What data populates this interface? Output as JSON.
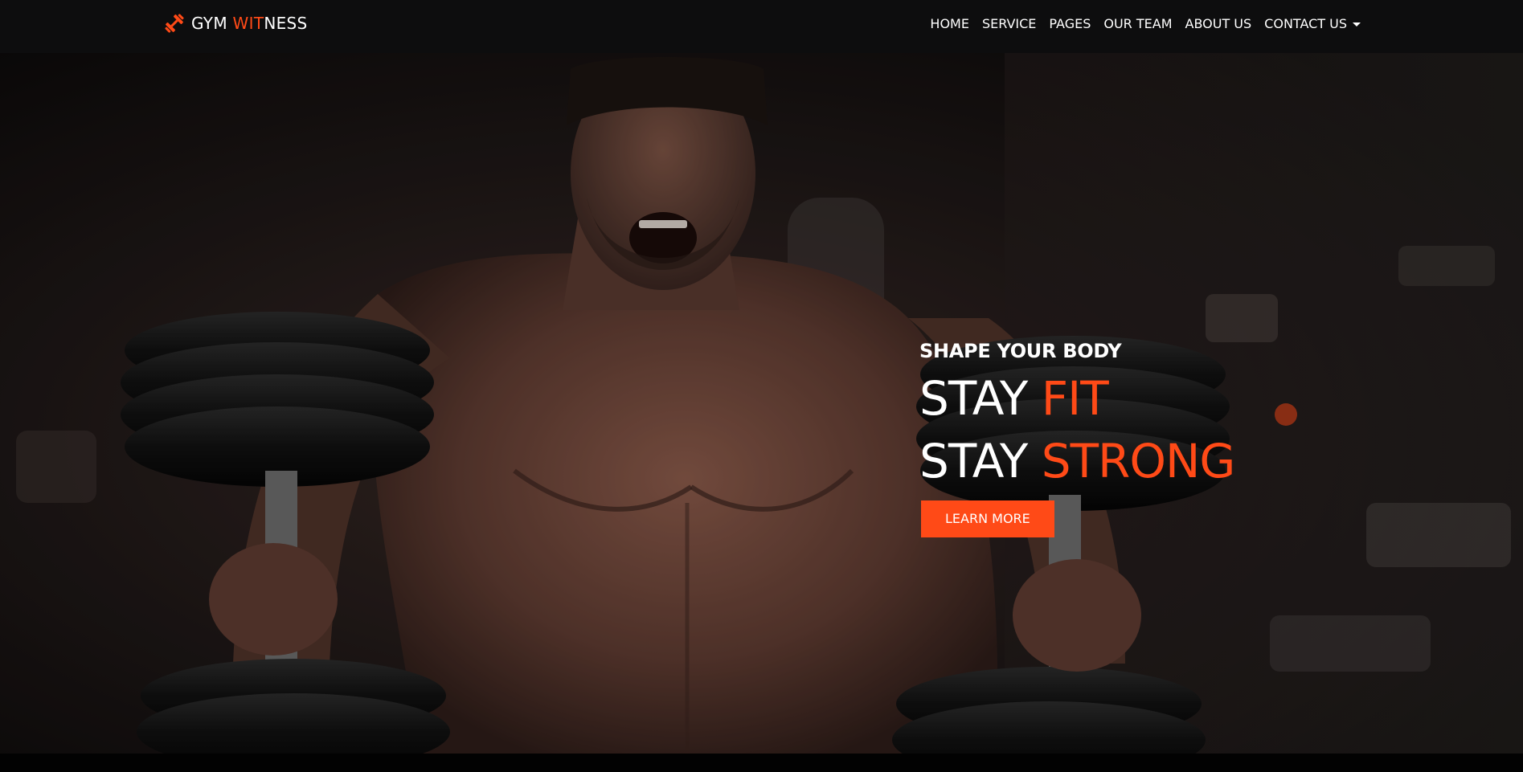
{
  "brand": {
    "name_part1": "GYM ",
    "name_accent": "WIT",
    "name_part2": "NESS",
    "icon": "dumbbell-icon",
    "accent_color": "#ff4a17"
  },
  "nav": {
    "items": [
      {
        "label": "HOME"
      },
      {
        "label": "SERVICE"
      },
      {
        "label": "PAGES"
      },
      {
        "label": "OUR TEAM"
      },
      {
        "label": "ABOUT US"
      },
      {
        "label": "CONTACT US",
        "dropdown": true
      }
    ]
  },
  "hero": {
    "subtitle": "SHAPE YOUR BODY",
    "line1_plain": "STAY ",
    "line1_accent": "FIT",
    "line2_plain": "STAY ",
    "line2_accent": "STRONG",
    "cta_label": "LEARN MORE",
    "image": "bodybuilder lifting dumbbells in gym"
  },
  "colors": {
    "accent": "#ff4a17",
    "navbar_bg": "#0d0d0e",
    "text": "#ffffff"
  }
}
